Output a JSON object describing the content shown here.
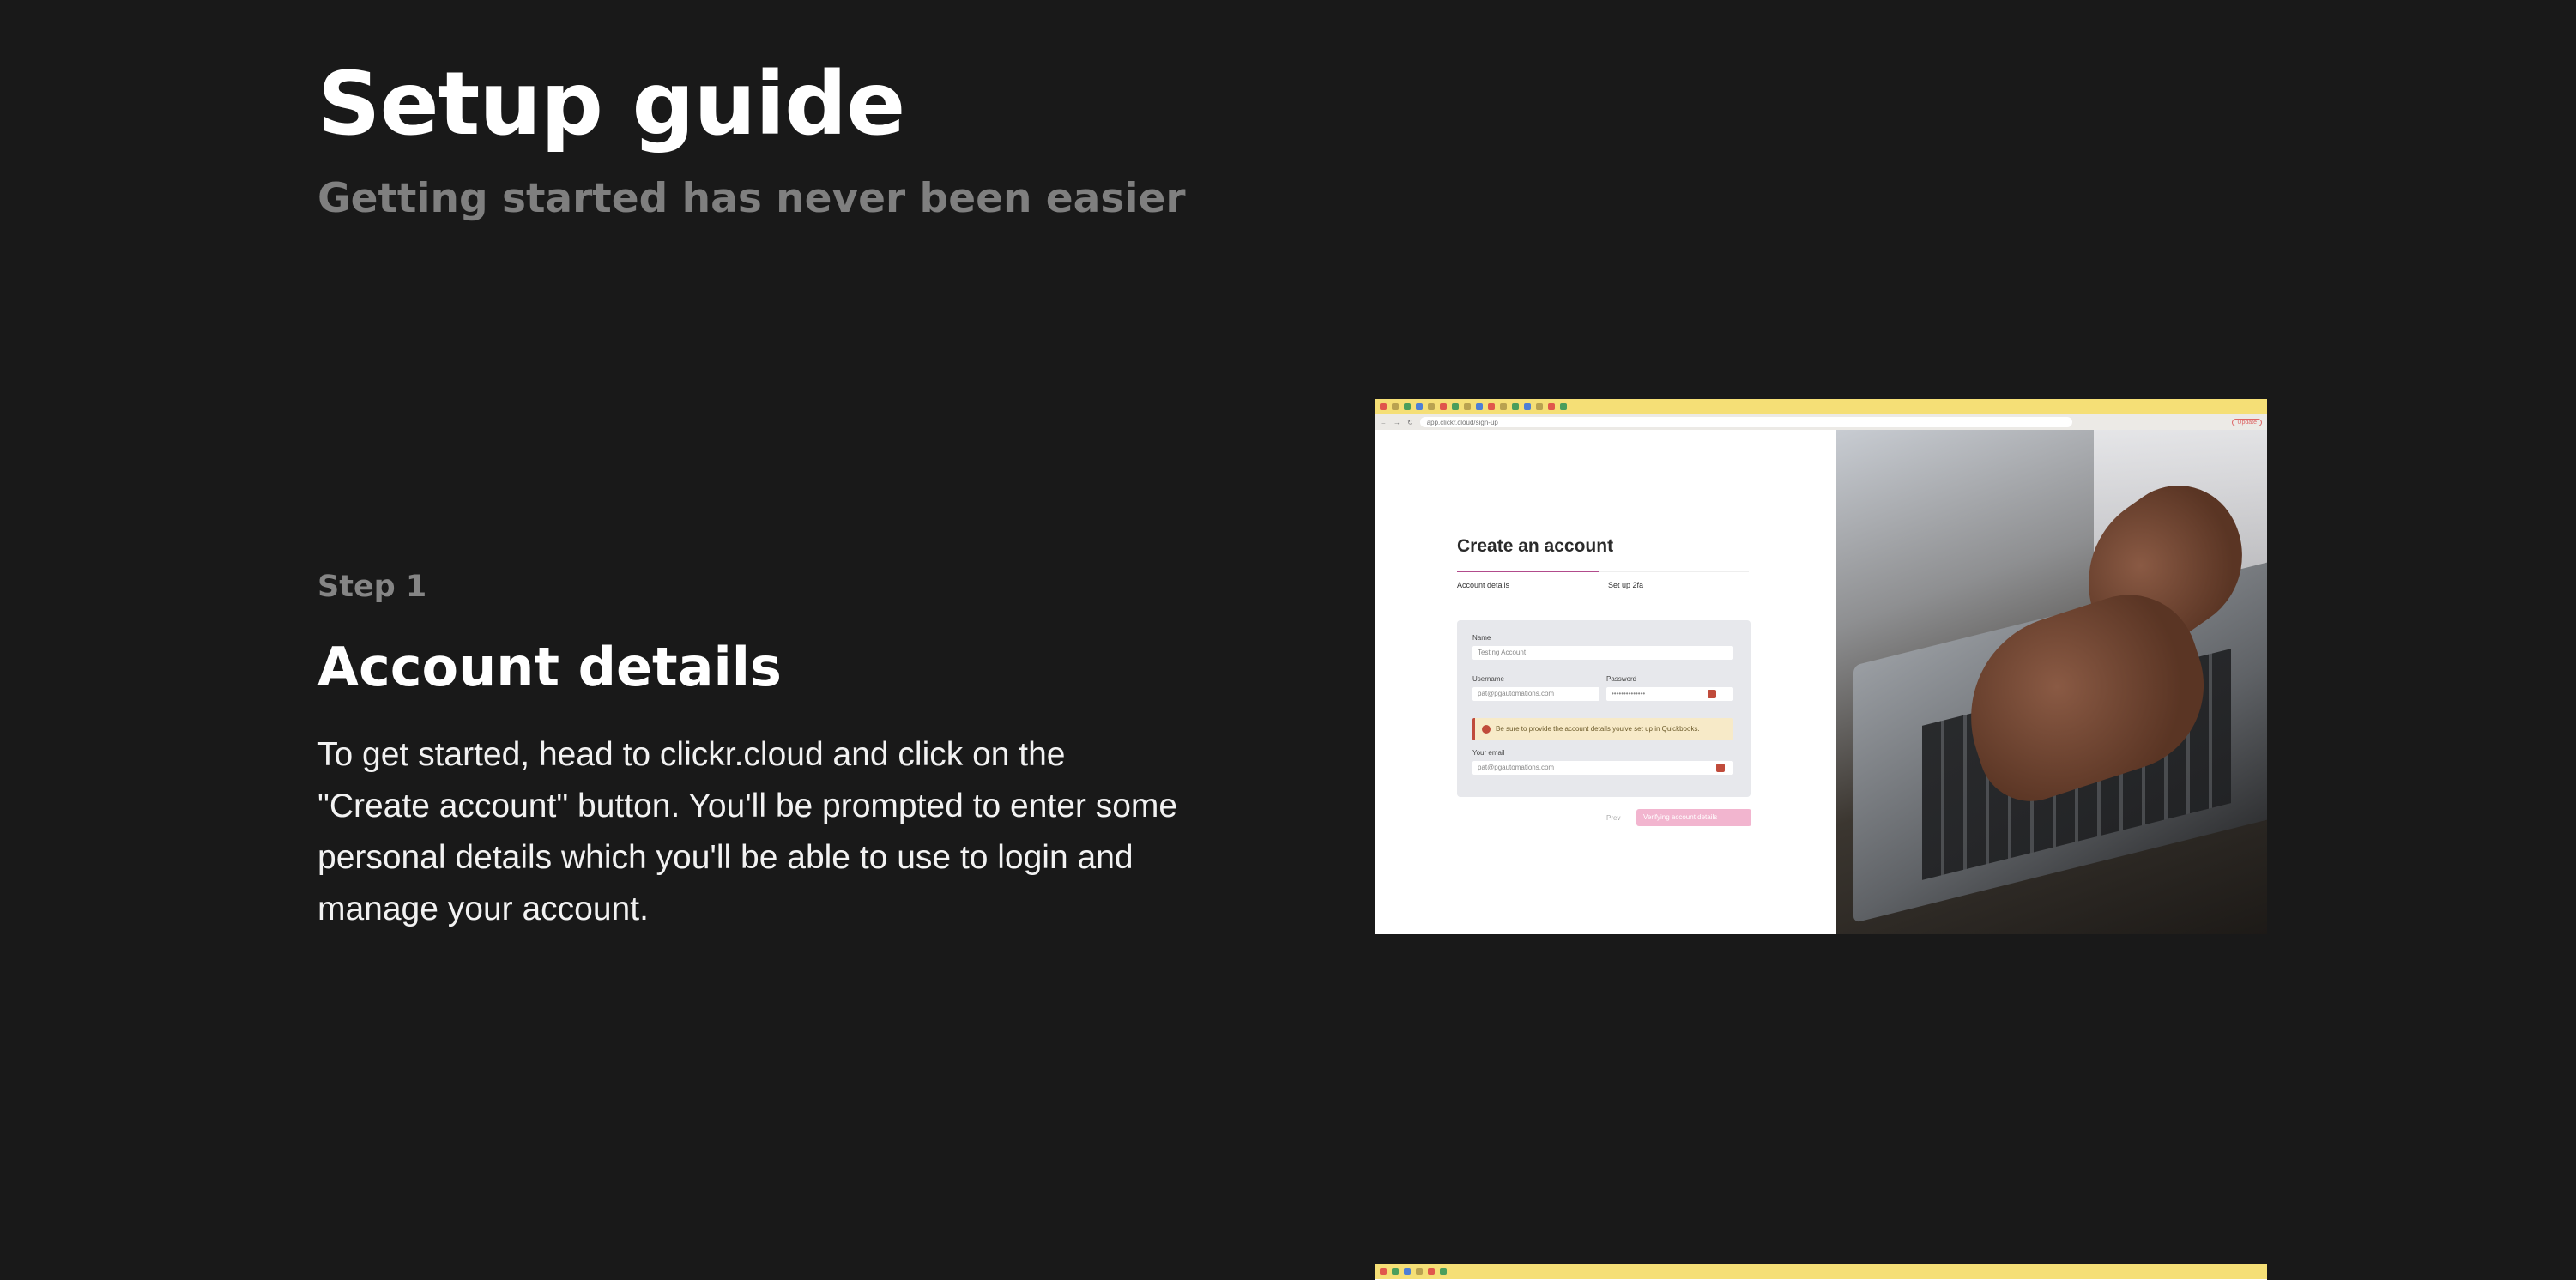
{
  "hero": {
    "title": "Setup guide",
    "subtitle": "Getting started has never been easier"
  },
  "steps": [
    {
      "label": "Step 1",
      "title": "Account details",
      "body": "To get started, head to clickr.cloud and click on the \"Create account\" button. You'll be prompted to enter some personal details which you'll be able to use to login and manage your account.",
      "screenshot": {
        "url": "app.clickr.cloud/sign-up",
        "update_label": "Update",
        "form": {
          "title": "Create an account",
          "tabs": [
            "Account details",
            "Set up 2fa"
          ],
          "name_label": "Name",
          "name_value": "Testing Account",
          "username_label": "Username",
          "username_value": "pat@pgautomations.com",
          "password_label": "Password",
          "password_value": "••••••••••••••",
          "warning": "Be sure to provide the account details you've set up in Quickbooks.",
          "email_label": "Your email",
          "email_value": "pat@pgautomations.com",
          "prev_label": "Prev",
          "submit_label": "Verifying account details"
        }
      }
    }
  ],
  "colors": {
    "background": "#191919",
    "muted_text": "#7f7f7f",
    "accent": "#b24b8c"
  }
}
